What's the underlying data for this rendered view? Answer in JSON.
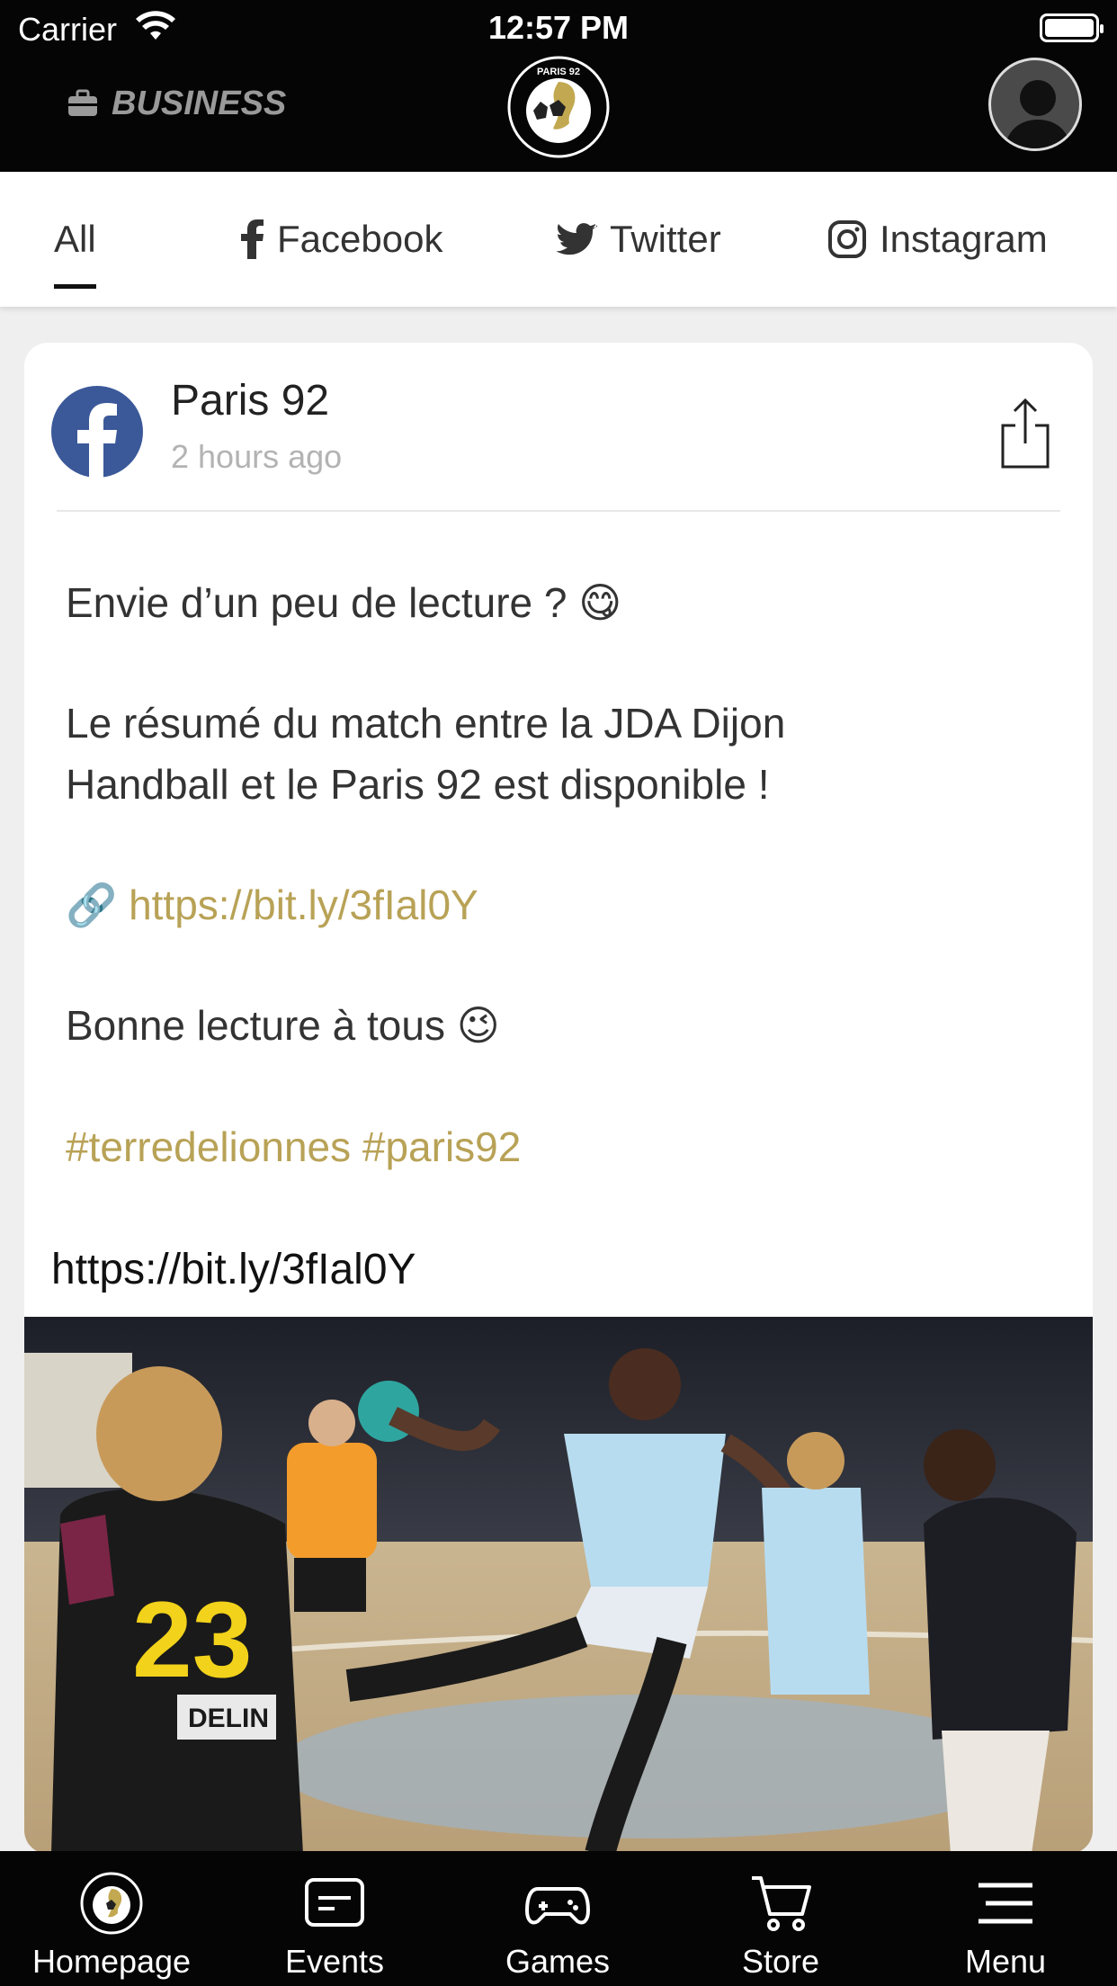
{
  "status_bar": {
    "carrier": "Carrier",
    "time": "12:57 PM"
  },
  "header": {
    "business_label": "BUSINESS",
    "logo_text": "PARIS 92"
  },
  "tabs": [
    {
      "label": "All",
      "icon": "none",
      "active": true
    },
    {
      "label": "Facebook",
      "icon": "facebook-icon",
      "active": false
    },
    {
      "label": "Twitter",
      "icon": "twitter-icon",
      "active": false
    },
    {
      "label": "Instagram",
      "icon": "instagram-icon",
      "active": false
    }
  ],
  "post": {
    "source_icon": "facebook-icon",
    "author": "Paris 92",
    "time_ago": "2 hours ago",
    "lines": {
      "line1": "Envie d’un peu de lecture ? 😋",
      "line2": "Le résumé du match entre la JDA Dijon",
      "line3": "Handball et le Paris 92 est disponible !",
      "link_emoji": "🔗",
      "link": "https://bit.ly/3fIal0Y",
      "line5": "Bonne lecture à tous 😉",
      "hashtags": "#terredelionnes #paris92"
    },
    "link_preview_url": "https://bit.ly/3fIal0Y",
    "photo_jersey_number": "23",
    "photo_sponsor": "DELIN"
  },
  "bottom_nav": [
    {
      "label": "Homepage",
      "icon": "paris92-logo-icon"
    },
    {
      "label": "Events",
      "icon": "message-icon"
    },
    {
      "label": "Games",
      "icon": "gamepad-icon"
    },
    {
      "label": "Store",
      "icon": "cart-icon"
    },
    {
      "label": "Menu",
      "icon": "menu-icon"
    }
  ],
  "colors": {
    "header_bg": "#050505",
    "accent_gold": "#b8a256",
    "facebook_blue": "#3b5999"
  }
}
